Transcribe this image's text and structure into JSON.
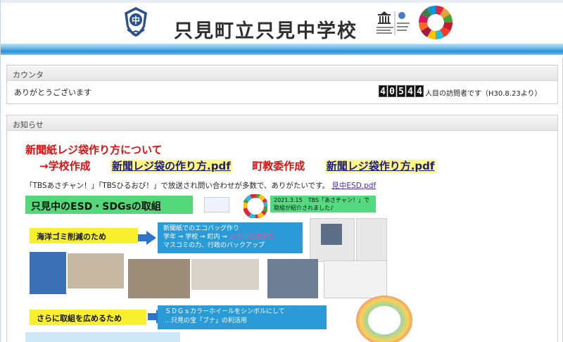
{
  "header": {
    "school_name": "只見町立只見中学校",
    "crest_letter": "中"
  },
  "counter": {
    "heading": "カウンタ",
    "thanks": "ありがとうございます",
    "digits": [
      "4",
      "0",
      "5",
      "4",
      "4"
    ],
    "visit_suffix": "人目の訪問者です（H30.8.23より）"
  },
  "news": {
    "heading": "お知らせ",
    "title": "新聞紙レジ袋作り方について",
    "school_made": "→学校作成",
    "school_pdf": "新聞レジ袋の作り方.pdf",
    "board_made": "町教委作成",
    "board_pdf": "新聞レジ袋作り方.pdf",
    "note": "「TBSあさチャン！」「TBSひるおび！」で放送され問い合わせが多数で、ありがたいです。",
    "esd_pdf": "見中ESD.pdf"
  },
  "poster": {
    "title": "只見中のESD・SDGsの取組",
    "tbs_note": "2021.3.15　TBS「あさチャン！」で 取組が紹介されました♪",
    "ocean": "海洋ゴミ削減のため",
    "eco_line1": "新聞紙でのエコバッグ作り",
    "eco_line2": "学年 ⇒ 学校 ⇒ 町内 ⇒",
    "eco_highlight": "さらなる広がり",
    "eco_line3": "マスコミの力、行政のバックアップ",
    "more": "さらに取組を広めるため",
    "wheel_line1": "ＳＤＧｓカラーホイールをシンボルにして",
    "wheel_line2": "…只見の宝「ブナ」の利活用"
  },
  "colors": {
    "accent_red": "#e01010",
    "stripe_blue": "#2a8fd6",
    "poster_green": "#53d87a",
    "poster_yellow": "#f8f02f",
    "poster_blue": "#2b9bd8",
    "link_highlight": "#fff87a"
  }
}
